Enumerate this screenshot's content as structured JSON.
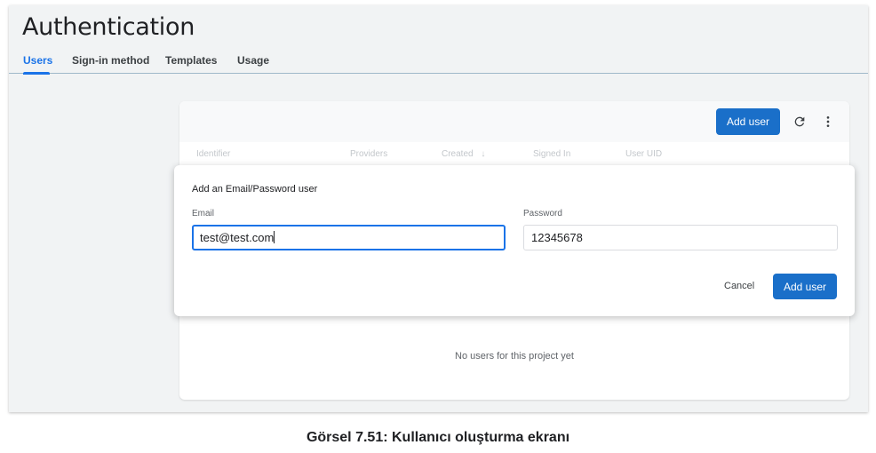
{
  "header": {
    "title": "Authentication"
  },
  "tabs": [
    {
      "label": "Users",
      "active": true
    },
    {
      "label": "Sign-in method",
      "active": false
    },
    {
      "label": "Templates",
      "active": false
    },
    {
      "label": "Usage",
      "active": false
    }
  ],
  "toolbar": {
    "add_user_label": "Add user",
    "refresh_icon": "refresh-icon",
    "more_icon": "more-vert-icon"
  },
  "table": {
    "columns": [
      "Identifier",
      "Providers",
      "Created",
      "Signed In",
      "User UID"
    ],
    "sort_icon": "arrow-down-icon",
    "empty_message": "No users for this project yet"
  },
  "dialog": {
    "title": "Add an Email/Password user",
    "email": {
      "label": "Email",
      "value": "test@test.com"
    },
    "password": {
      "label": "Password",
      "value": "12345678"
    },
    "cancel_label": "Cancel",
    "submit_label": "Add user"
  },
  "caption": "Görsel 7.51: Kullanıcı oluşturma ekranı",
  "colors": {
    "accent": "#1a73e8",
    "button": "#1a6fc9",
    "background": "#f1f3f4"
  }
}
